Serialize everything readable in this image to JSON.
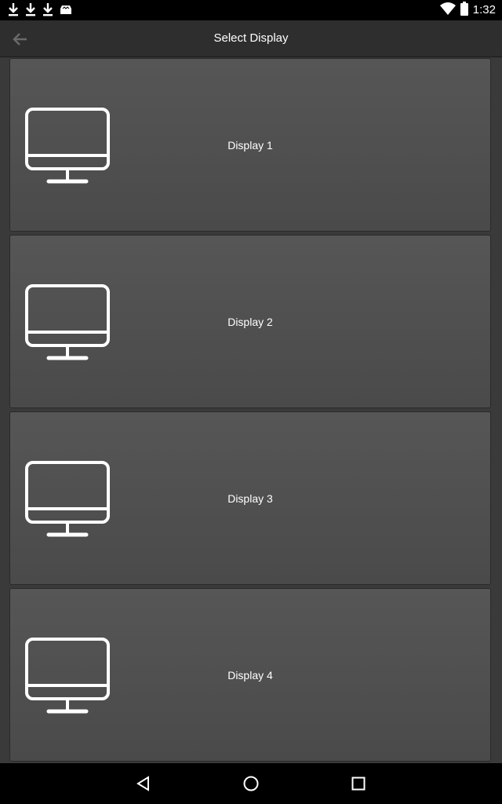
{
  "status_bar": {
    "time": "1:32",
    "left_icons": [
      "download-icon",
      "download-icon",
      "download-icon",
      "store-icon"
    ],
    "right_icons": [
      "wifi-icon",
      "battery-icon"
    ]
  },
  "app_bar": {
    "title": "Select Display",
    "back_icon": "arrow-left-icon"
  },
  "displays": [
    {
      "label": "Display 1",
      "icon": "monitor-icon"
    },
    {
      "label": "Display 2",
      "icon": "monitor-icon"
    },
    {
      "label": "Display 3",
      "icon": "monitor-icon"
    },
    {
      "label": "Display 4",
      "icon": "monitor-icon"
    }
  ],
  "nav_bar": {
    "back_icon": "nav-back-icon",
    "home_icon": "nav-home-icon",
    "recents_icon": "nav-recents-icon"
  },
  "colors": {
    "background": "#3a3a3a",
    "card": "#505050",
    "app_bar": "#2e2e2e",
    "text": "#ffffff"
  }
}
